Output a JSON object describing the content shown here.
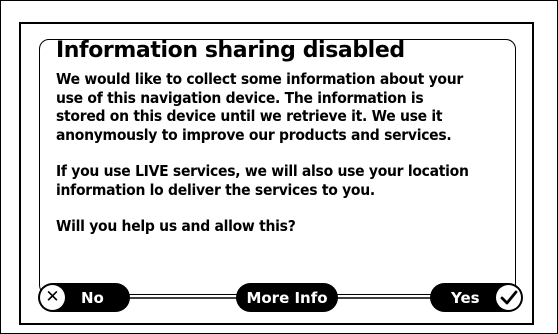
{
  "dialog": {
    "title": "Information sharing disabled",
    "paragraphs": [
      "We would like to collect some information about your use of this navigation device. The information is stored on this device until we retrieve it. We use it anonymously to improve our products and services.",
      "If you use LIVE services, we will also use your location information lo deliver the services to you.",
      "Will you help us and allow this?"
    ]
  },
  "buttons": {
    "no_label": "No",
    "more_info_label": "More Info",
    "yes_label": "Yes"
  },
  "icons": {
    "no": "close-icon",
    "yes": "checkmark-icon"
  }
}
